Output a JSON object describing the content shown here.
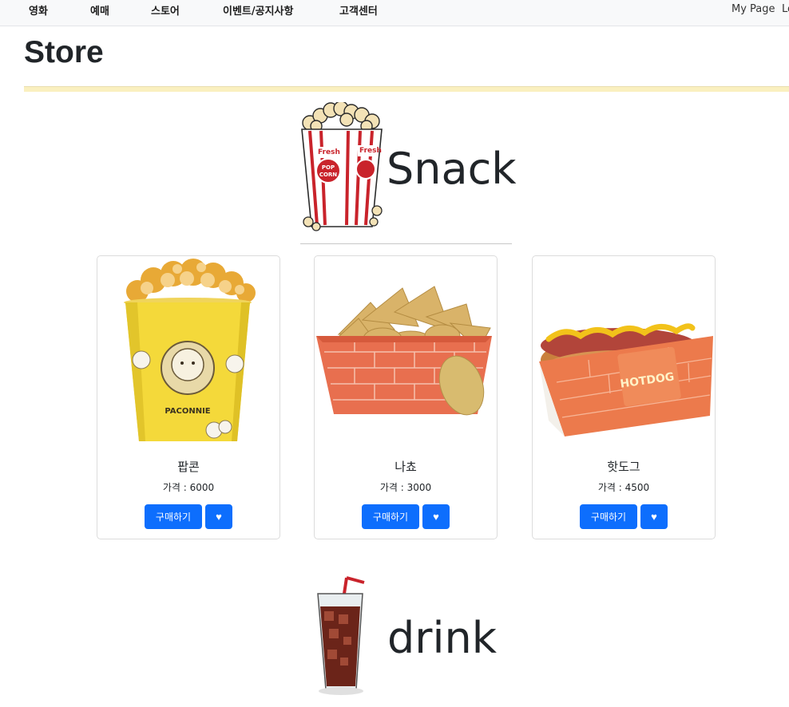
{
  "nav": {
    "items": [
      "영화",
      "예매",
      "스토어",
      "이벤트/공지사항",
      "고객센터"
    ],
    "my_page": "My Page",
    "login": "Lo"
  },
  "page": {
    "title": "Store"
  },
  "sections": {
    "snack": {
      "title": "Snack",
      "icon": "popcorn-box-icon"
    },
    "drink": {
      "title": "drink",
      "icon": "cola-glass-icon"
    }
  },
  "products": [
    {
      "name": "팝콘",
      "price": "가격 : 6000",
      "buy_label": "구매하기",
      "like_icon": "heart-icon",
      "image": "popcorn-cup-image",
      "cup_text": "PACONNIE"
    },
    {
      "name": "나쵸",
      "price": "가격 : 3000",
      "buy_label": "구매하기",
      "like_icon": "heart-icon",
      "image": "nachos-image"
    },
    {
      "name": "핫도그",
      "price": "가격 : 4500",
      "buy_label": "구매하기",
      "like_icon": "heart-icon",
      "image": "hotdog-image",
      "tray_text": "HOTDOG"
    }
  ],
  "colors": {
    "primary_button": "#0d6efd",
    "title_rule": "#faf0bf",
    "nav_bg": "#f8f9fa"
  }
}
